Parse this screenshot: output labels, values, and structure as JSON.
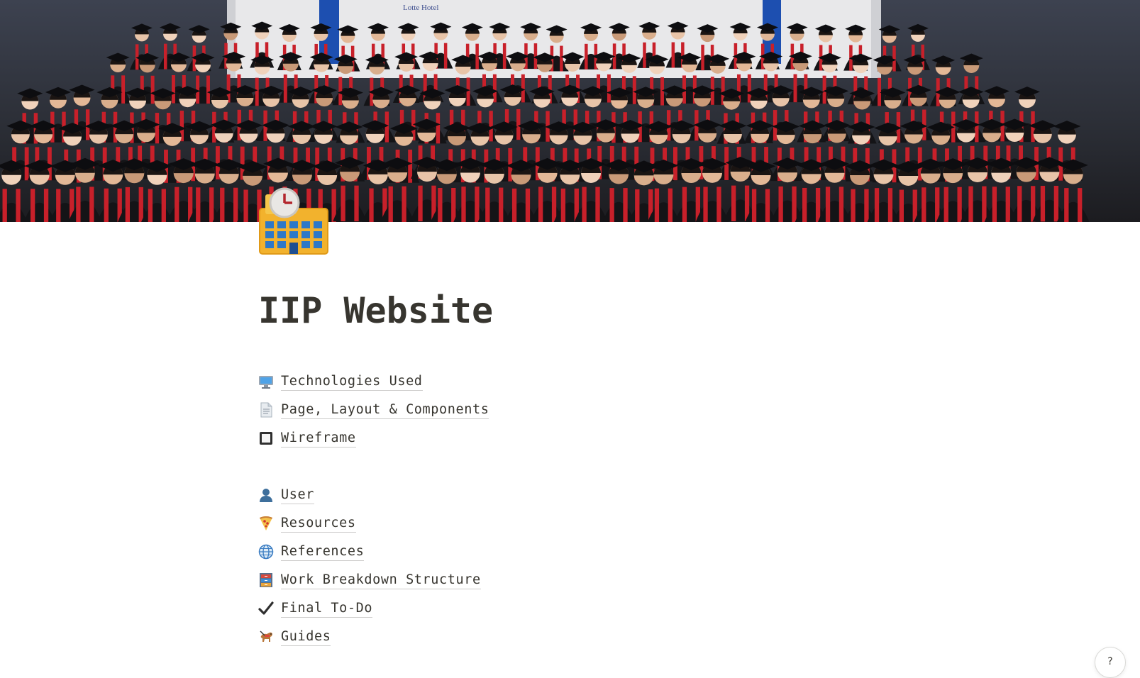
{
  "cover": {
    "sign_text": "Lotte Hotel",
    "image_kind": "graduation-group-photo"
  },
  "page": {
    "icon": "hospital-clock-building-icon",
    "title": "IIP Website"
  },
  "links_primary": [
    {
      "icon": "computer-icon",
      "label": "Technologies Used"
    },
    {
      "icon": "page-icon",
      "label": "Page, Layout & Components"
    },
    {
      "icon": "square-frame-icon",
      "label": "Wireframe"
    }
  ],
  "links_secondary": [
    {
      "icon": "user-icon",
      "label": "User"
    },
    {
      "icon": "pizza-icon",
      "label": "Resources"
    },
    {
      "icon": "globe-icon",
      "label": "References"
    },
    {
      "icon": "file-cabinet-icon",
      "label": "Work Breakdown Structure"
    },
    {
      "icon": "checkmark-icon",
      "label": "Final To-Do"
    },
    {
      "icon": "guide-dog-icon",
      "label": "Guides"
    }
  ],
  "help": {
    "label": "?"
  },
  "colors": {
    "text": "#37352f",
    "gown": "#141417",
    "stole": "#c8202a",
    "backdrop": "#3d4250"
  }
}
